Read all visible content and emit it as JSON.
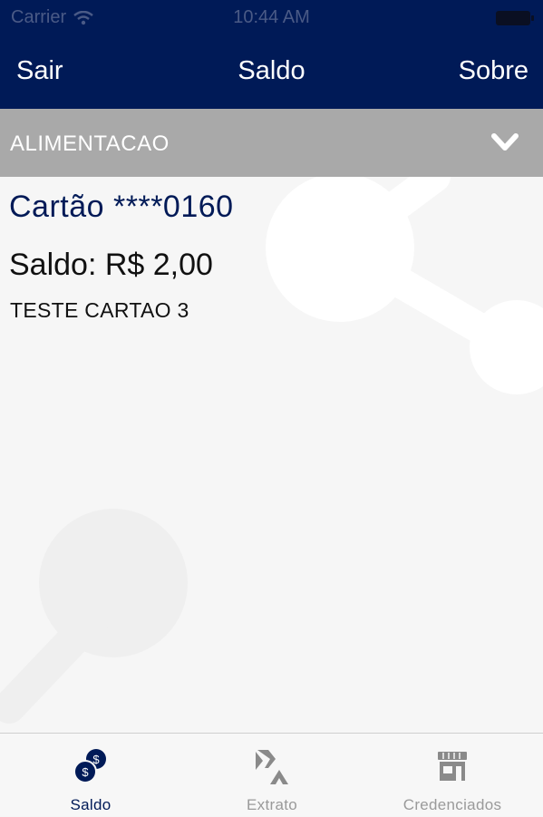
{
  "status_bar": {
    "carrier": "Carrier",
    "time": "10:44 AM"
  },
  "nav": {
    "left_label": "Sair",
    "title": "Saldo",
    "right_label": "Sobre"
  },
  "selector": {
    "label": "ALIMENTACAO",
    "icon": "chevron-down-icon"
  },
  "card": {
    "number": "Cartão ****0160",
    "balance": "Saldo: R$ 2,00",
    "holder": "TESTE CARTAO 3"
  },
  "tabs": [
    {
      "label": "Saldo",
      "icon": "coins-icon",
      "active": true
    },
    {
      "label": "Extrato",
      "icon": "arrows-icon",
      "active": false
    },
    {
      "label": "Credenciados",
      "icon": "store-icon",
      "active": false
    }
  ],
  "colors": {
    "nav_bg": "#001a57",
    "selector_bg": "#a9a9a9",
    "active_tab": "#001a57",
    "inactive_tab": "#9a9a9a"
  }
}
